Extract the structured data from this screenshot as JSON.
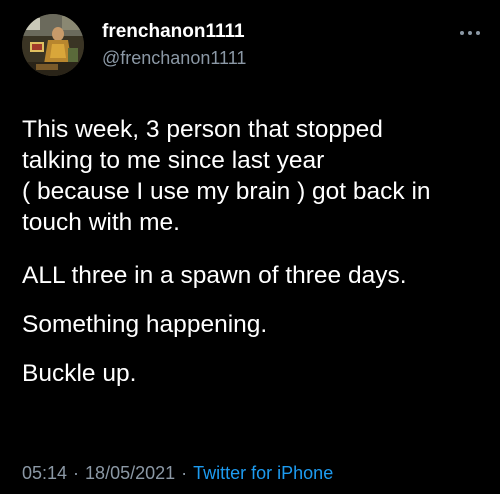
{
  "tweet": {
    "author": {
      "display_name": "frenchanon1111",
      "handle": "@frenchanon1111",
      "avatar_icon": "painting-avatar-icon"
    },
    "more_icon": "more-horizontal-icon",
    "lines": [
      "This week, 3 person that stopped",
      "talking to me since last year",
      "( because I use my brain ) got back in",
      "touch with me."
    ],
    "paragraphs": [
      "ALL three in a spawn of three days.",
      "Something happening.",
      "Buckle up."
    ],
    "time": "05:14",
    "date": "18/05/2021",
    "separator": "·",
    "source": "Twitter for iPhone"
  },
  "colors": {
    "background": "#000000",
    "text": "#ffffff",
    "secondary": "#8b98a5",
    "link": "#1d9bf0"
  }
}
